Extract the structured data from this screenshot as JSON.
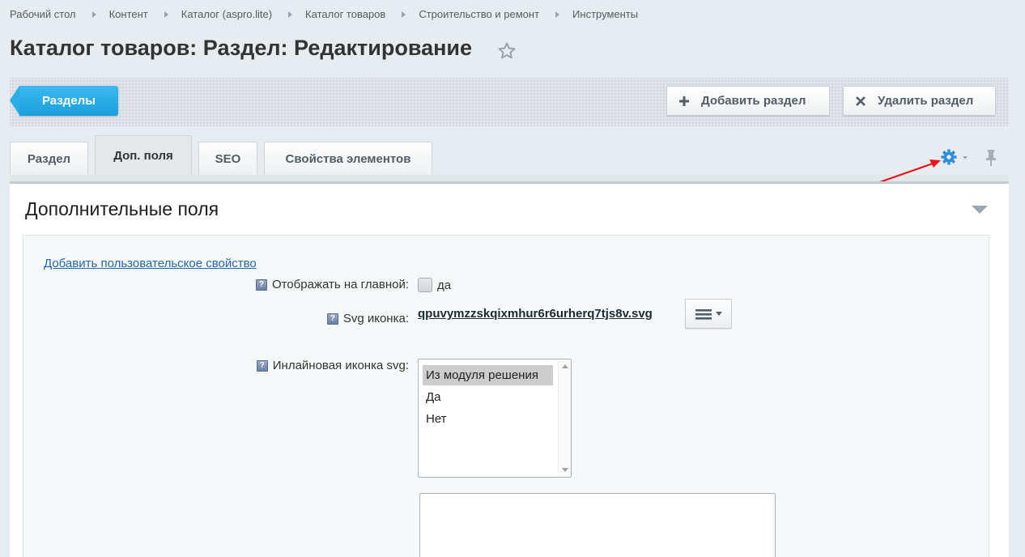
{
  "breadcrumbs": [
    "Рабочий стол",
    "Контент",
    "Каталог (aspro.lite)",
    "Каталог товаров",
    "Строительство и ремонт",
    "Инструменты"
  ],
  "page": {
    "title": "Каталог товаров: Раздел: Редактирование"
  },
  "toolbar": {
    "sections_label": "Разделы",
    "add_label": "Добавить раздел",
    "delete_label": "Удалить раздел"
  },
  "tabs": [
    {
      "label": "Раздел"
    },
    {
      "label": "Доп. поля",
      "active": true
    },
    {
      "label": "SEO"
    },
    {
      "label": "Свойства элементов"
    }
  ],
  "panel": {
    "title": "Дополнительные поля",
    "add_property_link": "Добавить пользовательское свойство",
    "help_glyph": "?",
    "fields": {
      "show_on_main": {
        "label": "Отображать на главной:",
        "checkbox_label": "да",
        "checked": false
      },
      "svg_icon": {
        "label": "Svg иконка:",
        "file_name": "qpuvymzzskqixmhur6r6urherq7tjs8v.svg"
      },
      "inline_svg": {
        "label": "Инлайновая иконка svg:",
        "options": [
          "Из модуля решения",
          "Да",
          "Нет"
        ],
        "selected": "Из модуля решения"
      }
    }
  },
  "colors": {
    "accent_blue": "#1a9fdc",
    "gear_blue": "#2f8fd8",
    "annotation_red": "#e8141c"
  },
  "icons": [
    "star-icon",
    "plus-icon",
    "close-icon",
    "gear-icon",
    "pin-icon",
    "collapse-triangle-icon",
    "help-icon",
    "menu-icon"
  ]
}
